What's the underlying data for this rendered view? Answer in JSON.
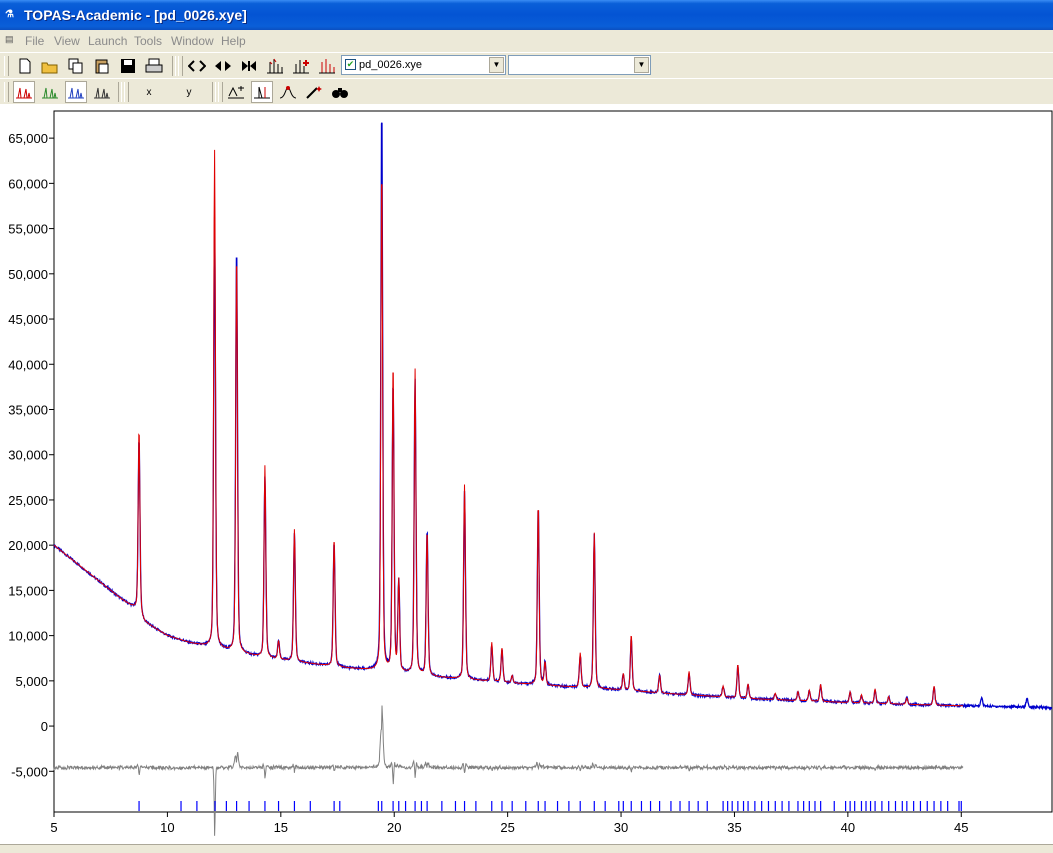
{
  "window": {
    "title": "TOPAS-Academic - [pd_0026.xye]",
    "app_icon": "topas-app-icon"
  },
  "menu": [
    "File",
    "View",
    "Launch",
    "Tools",
    "Window",
    "Help"
  ],
  "toolbar1": {
    "buttons": [
      "new-file-icon",
      "open-folder-icon",
      "copy-icon",
      "paste-icon",
      "save-icon",
      "print-icon",
      "expand-x-icon",
      "left-right-icon",
      "shrink-icon",
      "peaks-icon",
      "peaks-up-icon",
      "peaks-red-icon",
      "peaks-fit-icon"
    ],
    "file_combo": {
      "value": "pd_0026.xye",
      "checked": true
    },
    "second_combo": {
      "value": ""
    }
  },
  "toolbar2": {
    "buttons": [
      "pattern-red-icon",
      "pattern-green-icon",
      "pattern-blue-icon",
      "pattern-dark-icon"
    ],
    "x_label": "x",
    "y_label": "y",
    "tools": [
      "scale-icon",
      "peak-select-icon",
      "peak-marker-icon",
      "wand-icon",
      "binoculars-icon"
    ]
  },
  "colors": {
    "observed": "#0000cc",
    "calculated": "#e00000",
    "difference": "#808080",
    "ticks": "#0000ff"
  },
  "chart_data": {
    "type": "line",
    "xlim": [
      5,
      49
    ],
    "ylim": [
      -9500,
      68000
    ],
    "x_ticks": [
      5,
      10,
      15,
      20,
      25,
      30,
      35,
      40,
      45
    ],
    "x_tick_labels": [
      "5",
      "10",
      "15",
      "20",
      "25",
      "30",
      "35",
      "40",
      "45"
    ],
    "y_ticks": [
      -5000,
      0,
      5000,
      10000,
      15000,
      20000,
      25000,
      30000,
      35000,
      40000,
      45000,
      50000,
      55000,
      60000,
      65000
    ],
    "y_tick_labels": [
      "-5,000",
      "0",
      "5,000",
      "10,000",
      "15,000",
      "20,000",
      "25,000",
      "30,000",
      "35,000",
      "40,000",
      "45,000",
      "50,000",
      "55,000",
      "60,000",
      "65,000"
    ],
    "background": [
      [
        5,
        20000
      ],
      [
        6,
        18000
      ],
      [
        7,
        16000
      ],
      [
        8,
        14000
      ],
      [
        8.6,
        13000
      ],
      [
        9,
        11500
      ],
      [
        10,
        10000
      ],
      [
        11,
        9200
      ],
      [
        12,
        8700
      ],
      [
        14,
        7700
      ],
      [
        16,
        7000
      ],
      [
        18,
        6400
      ],
      [
        20,
        6000
      ],
      [
        22,
        5400
      ],
      [
        24,
        5000
      ],
      [
        26,
        4600
      ],
      [
        28,
        4300
      ],
      [
        30,
        4000
      ],
      [
        32,
        3600
      ],
      [
        34,
        3300
      ],
      [
        36,
        3000
      ],
      [
        38,
        2800
      ],
      [
        40,
        2600
      ],
      [
        42,
        2450
      ],
      [
        44,
        2300
      ],
      [
        46,
        2200
      ],
      [
        48,
        2100
      ],
      [
        49,
        2000
      ]
    ],
    "peaks": [
      {
        "x": 8.75,
        "height": 20500,
        "obs_height": 19500
      },
      {
        "x": 12.08,
        "height": 55000,
        "obs_height": 47600
      },
      {
        "x": 13.05,
        "height": 44200,
        "obs_height": 45000
      },
      {
        "x": 14.3,
        "height": 21200,
        "obs_height": 20000
      },
      {
        "x": 14.9,
        "height": 2000,
        "obs_height": 2000
      },
      {
        "x": 15.6,
        "height": 14600,
        "obs_height": 14200
      },
      {
        "x": 17.35,
        "height": 14200,
        "obs_height": 13800
      },
      {
        "x": 19.45,
        "height": 55700,
        "obs_height": 62500
      },
      {
        "x": 19.95,
        "height": 34000,
        "obs_height": 32000
      },
      {
        "x": 20.2,
        "height": 10000,
        "obs_height": 10000
      },
      {
        "x": 20.92,
        "height": 33700,
        "obs_height": 32500
      },
      {
        "x": 21.45,
        "height": 16000,
        "obs_height": 16200
      },
      {
        "x": 23.1,
        "height": 21500,
        "obs_height": 20800
      },
      {
        "x": 24.3,
        "height": 4300,
        "obs_height": 4000
      },
      {
        "x": 24.75,
        "height": 3800,
        "obs_height": 3600
      },
      {
        "x": 25.2,
        "height": 800,
        "obs_height": 800
      },
      {
        "x": 26.35,
        "height": 20000,
        "obs_height": 19800
      },
      {
        "x": 26.65,
        "height": 2500,
        "obs_height": 2500
      },
      {
        "x": 28.2,
        "height": 3800,
        "obs_height": 3600
      },
      {
        "x": 28.82,
        "height": 17200,
        "obs_height": 17000
      },
      {
        "x": 30.1,
        "height": 1800,
        "obs_height": 1800
      },
      {
        "x": 30.45,
        "height": 6200,
        "obs_height": 5700
      },
      {
        "x": 31.7,
        "height": 2000,
        "obs_height": 2000
      },
      {
        "x": 33.0,
        "height": 2600,
        "obs_height": 2400
      },
      {
        "x": 34.5,
        "height": 1200,
        "obs_height": 1200
      },
      {
        "x": 35.15,
        "height": 3700,
        "obs_height": 3500
      },
      {
        "x": 35.6,
        "height": 1600,
        "obs_height": 1500
      },
      {
        "x": 36.8,
        "height": 700,
        "obs_height": 700
      },
      {
        "x": 37.8,
        "height": 1000,
        "obs_height": 1000
      },
      {
        "x": 38.3,
        "height": 1200,
        "obs_height": 1200
      },
      {
        "x": 38.8,
        "height": 1900,
        "obs_height": 1800
      },
      {
        "x": 40.1,
        "height": 1200,
        "obs_height": 1200
      },
      {
        "x": 40.6,
        "height": 900,
        "obs_height": 900
      },
      {
        "x": 41.2,
        "height": 1600,
        "obs_height": 1500
      },
      {
        "x": 41.8,
        "height": 800,
        "obs_height": 800
      },
      {
        "x": 42.6,
        "height": 700,
        "obs_height": 700
      },
      {
        "x": 43.8,
        "height": 2100,
        "obs_height": 2000
      },
      {
        "x": 45.9,
        "height": 0,
        "obs_height": 900
      },
      {
        "x": 47.9,
        "height": 0,
        "obs_height": 1000
      }
    ],
    "calc_end_x": 45.1,
    "difference_offset": -4600,
    "tick_marks": [
      8.75,
      10.6,
      11.3,
      12.1,
      12.6,
      13.05,
      13.6,
      14.3,
      14.9,
      15.6,
      16.3,
      17.35,
      17.6,
      19.3,
      19.45,
      19.95,
      20.2,
      20.5,
      20.92,
      21.2,
      21.45,
      22.1,
      22.7,
      23.1,
      23.6,
      24.3,
      24.75,
      25.2,
      25.8,
      26.35,
      26.65,
      27.2,
      27.7,
      28.2,
      28.82,
      29.3,
      29.9,
      30.1,
      30.45,
      30.9,
      31.3,
      31.7,
      32.2,
      32.6,
      33.0,
      33.4,
      33.8,
      34.5,
      34.7,
      34.9,
      35.15,
      35.4,
      35.6,
      35.9,
      36.2,
      36.5,
      36.8,
      37.1,
      37.4,
      37.8,
      38.05,
      38.3,
      38.55,
      38.8,
      39.4,
      39.9,
      40.1,
      40.3,
      40.6,
      40.8,
      41.0,
      41.2,
      41.5,
      41.8,
      42.1,
      42.4,
      42.6,
      42.9,
      43.2,
      43.5,
      43.8,
      44.1,
      44.4,
      44.9,
      45.0
    ]
  }
}
